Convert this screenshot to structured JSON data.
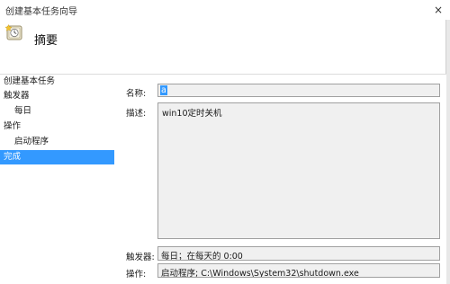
{
  "window": {
    "title": "创建基本任务向导",
    "close_glyph": "×"
  },
  "header": {
    "icon": "task-wizard-clock-icon",
    "title": "摘要"
  },
  "sidebar": {
    "steps": [
      {
        "label": "创建基本任务",
        "level": 0,
        "active": false
      },
      {
        "label": "触发器",
        "level": 0,
        "active": false
      },
      {
        "label": "每日",
        "level": 1,
        "active": false
      },
      {
        "label": "操作",
        "level": 0,
        "active": false
      },
      {
        "label": "启动程序",
        "level": 1,
        "active": false
      },
      {
        "label": "完成",
        "level": 0,
        "active": true
      }
    ]
  },
  "summary": {
    "name_label": "名称:",
    "name_value": "a",
    "description_label": "描述:",
    "description_value": "win10定时关机",
    "trigger_label": "触发器:",
    "trigger_value": "每日；在每天的 0:00",
    "action_label": "操作:",
    "action_value": "启动程序; C:\\Windows\\System32\\shutdown.exe"
  },
  "colors": {
    "selection": "#3399ff",
    "field_bg": "#f0f0f0",
    "field_border": "#a0a0a0"
  }
}
